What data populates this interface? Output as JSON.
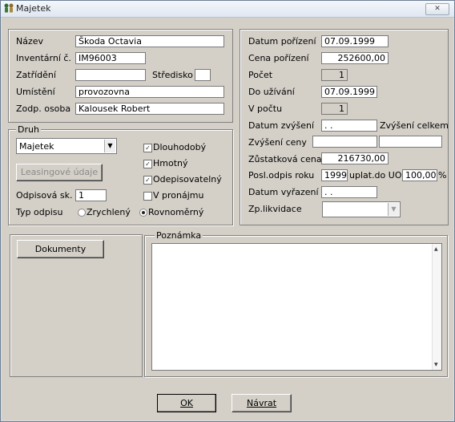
{
  "window": {
    "title": "Majetek",
    "close_icon": "close-icon"
  },
  "basic": {
    "nazev_label": "Název",
    "nazev_value": "Škoda Octavia",
    "inv_label": "Inventární č.",
    "inv_value": "IM96003",
    "zatrideni_label": "Zatřídění",
    "zatrideni_value": "",
    "stredisko_label": "Středisko",
    "stredisko_value": "",
    "umisteni_label": "Umístění",
    "umisteni_value": "provozovna",
    "zodp_label": "Zodp. osoba",
    "zodp_value": "Kalousek Robert"
  },
  "druh": {
    "group_label": "Druh",
    "combo_value": "Majetek",
    "leasing_button": "Leasingové údaje",
    "dlouhodoby_label": "Dlouhodobý",
    "dlouhodoby_checked": true,
    "hmotny_label": "Hmotný",
    "hmotny_checked": true,
    "odepis_label": "Odepisovatelný",
    "odepis_checked": true,
    "pronajem_label": "V pronájmu",
    "pronajem_checked": false,
    "odpisova_label": "Odpisová sk.",
    "odpisova_value": "1",
    "typ_label": "Typ odpisu",
    "zrychleny_label": "Zrychlený",
    "rovnomerny_label": "Rovnoměrný",
    "selected_typ": "Rovnoměrný"
  },
  "right": {
    "datum_porizeni_label": "Datum pořízení",
    "datum_porizeni_value": "07.09.1999",
    "cena_porizeni_label": "Cena pořízení",
    "cena_porizeni_value": "252600,00",
    "pocet_label": "Počet",
    "pocet_value": "1",
    "do_uzivani_label": "Do užívání",
    "do_uzivani_value": "07.09.1999",
    "v_poctu_label": "V počtu",
    "v_poctu_value": "1",
    "datum_zvyseni_label": "Datum zvýšení",
    "datum_zvyseni_value": " . .",
    "zvyseni_celkem_label": "Zvýšení celkem",
    "zvyseni_ceny_label": "Zvýšení ceny",
    "zvyseni_ceny_value": "",
    "zvyseni_celkem_value": "",
    "zustatkova_label": "Zůstatková cena",
    "zustatkova_value": "216730,00",
    "posl_odpis_label": "Posl.odpis roku",
    "posl_odpis_value": "1999",
    "uplat_label": "uplat.do UO",
    "uplat_value": "100,00",
    "uplat_unit": "%",
    "vyrazeni_label": "Datum vyřazení",
    "vyrazeni_value": " . .",
    "likvidace_label": "Zp.likvidace",
    "likvidace_value": ""
  },
  "bottom": {
    "dokumenty_button": "Dokumenty",
    "poznamka_label": "Poznámka",
    "poznamka_value": ""
  },
  "footer": {
    "ok_button": "OK",
    "navrat_button": "Návrat"
  }
}
